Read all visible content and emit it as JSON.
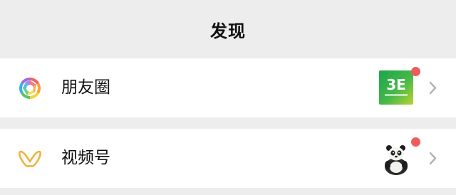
{
  "header": {
    "title": "发现"
  },
  "items": [
    {
      "label": "朋友圈",
      "icon": "camera-shutter-icon",
      "thumbnail_text": "3E",
      "has_badge": true
    },
    {
      "label": "视频号",
      "icon": "butterfly-icon",
      "thumbnail": "panda-avatar",
      "has_badge": true
    }
  ],
  "colors": {
    "background": "#ededed",
    "row_background": "#ffffff",
    "badge": "#f25b5b",
    "chevron": "#b2b2b2",
    "channels_icon": "#f0b341"
  }
}
